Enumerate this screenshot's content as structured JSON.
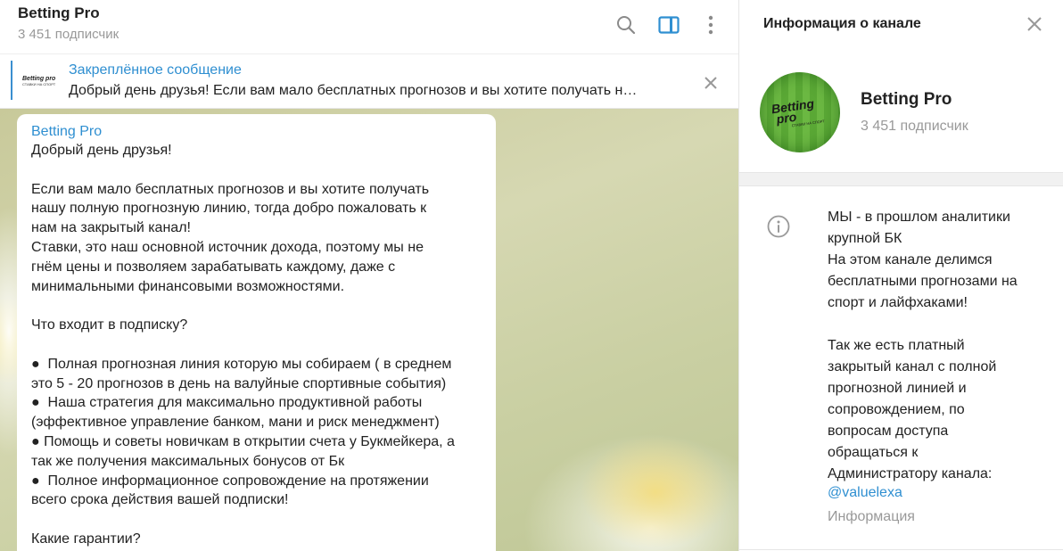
{
  "header": {
    "title": "Betting Pro",
    "subscribers": "3 451 подписчик",
    "search_icon": "search-icon",
    "panel_icon": "sidebar-toggle-icon",
    "more_icon": "more-vertical-icon"
  },
  "pinned": {
    "title": "Закреплённое сообщение",
    "preview": "Добрый день друзья!   Если вам мало бесплатных прогнозов и вы хотите получать н…",
    "thumb_line1": "Betting pro",
    "thumb_line2": "СТАВКИ НА СПОРТ"
  },
  "message": {
    "author": "Betting Pro",
    "text": "Добрый день друзья!\n\nЕсли вам мало бесплатных прогнозов и вы хотите получать\nнашу полную прогнозную линию, тогда добро пожаловать к\nнам на закрытый канал!\nСтавки, это наш основной источник дохода, поэтому мы не\nгнём цены и позволяем зарабатывать каждому, даже с\nминимальными финансовыми возможностями.\n\nЧто входит в подписку?\n\n●  Полная прогнозная линия которую мы собираем ( в среднем\nэто 5 - 20 прогнозов в день на валуйные спортивные события)\n●  Наша стратегия для максимально продуктивной работы\n(эффективное управление банком, мани и риск менеджмент)\n● Помощь и советы новичкам в открытии счета у Букмейкера, а\nтак же получения максимальных бонусов от Бк\n●  Полное информационное сопровождение на протяжении\nвсего срока действия вашей подписки!\n\nКакие гарантии?"
  },
  "info_panel": {
    "title": "Информация о канале",
    "channel_name": "Betting Pro",
    "subscribers": "3 451 подписчик",
    "avatar_line1": "Betting",
    "avatar_line2": "pro",
    "avatar_line3": "СТАВКИ НА СПОРТ",
    "description": "МЫ - в прошлом аналитики\nкрупной БК\nНа этом канале делимся\nбесплатными прогнозами на\nспорт и лайфхаками!\n\nТак же есть платный\nзакрытый канал с полной\nпрогнозной линией и\nсопровождением, по\nвопросам доступа\nобращаться к\nАдминистратору канала:",
    "admin_link": "@valuelexa",
    "description_label": "Информация"
  },
  "colors": {
    "accent": "#2f8fd1",
    "muted": "#999999",
    "text": "#222222"
  }
}
